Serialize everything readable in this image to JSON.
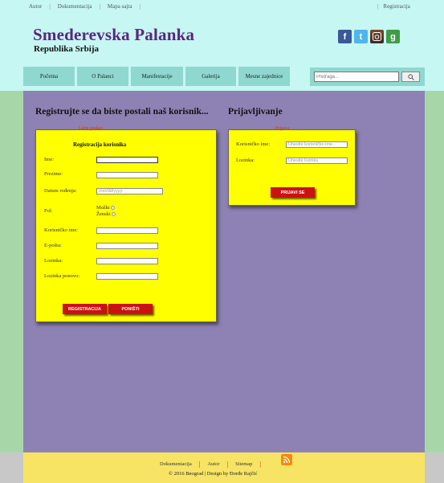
{
  "header": {
    "top_links": [
      "Autor",
      "Dokumentacija",
      "Mapa sajta"
    ],
    "register_link": "Registracija",
    "site_title": "Smederevska Palanka",
    "site_subtitle": "Republika Srbija",
    "social_icons": [
      "facebook-icon",
      "twitter-icon",
      "instagram-icon",
      "google-plus-icon"
    ]
  },
  "nav": {
    "items": [
      "Početna",
      "O Palanci",
      "Manifestacije",
      "Galerija",
      "Mesne zajednice"
    ],
    "search_placeholder": "Pretraga..."
  },
  "registration": {
    "heading": "Registrujte se da biste postali naš korisnik...",
    "legend": "Lični podaci",
    "form_title": "Registracija korisnika",
    "fields": [
      {
        "label": "Ime:",
        "placeholder": ""
      },
      {
        "label": "Prezime:",
        "placeholder": ""
      },
      {
        "label": "Datum rođenja:",
        "placeholder": "mm/dd/yyyy"
      },
      {
        "label": "Pol:",
        "placeholder": ""
      },
      {
        "label": "Korisničko ime:",
        "placeholder": ""
      },
      {
        "label": "E-pošta:",
        "placeholder": ""
      },
      {
        "label": "Lozinka:",
        "placeholder": ""
      },
      {
        "label": "Lozinka ponovo:",
        "placeholder": ""
      }
    ],
    "gender_options": [
      "Muški",
      "Ženski"
    ],
    "register_button": "REGISTRACIJA",
    "reset_button": "PONIŠTI"
  },
  "login": {
    "heading": "Prijavljivanje",
    "legend": "Prijava",
    "fields": [
      {
        "label": "Korisničko ime:",
        "placeholder": "Unesite korisničko ime..."
      },
      {
        "label": "Lozinka:",
        "placeholder": "Unesite lozinku"
      }
    ],
    "submit_button": "PRIJAVI SE"
  },
  "footer": {
    "links": [
      "Dokumentacija",
      "Autor",
      "Sitemap"
    ],
    "copyright": "© 2016 Beograd | Design by Đorđe Rajčić"
  },
  "colors": {
    "header_bg": "#c6f7f3",
    "nav_bg": "#8fd8cf",
    "main_bg": "#8e82b4",
    "panel_bg": "#ffff00",
    "title_color": "#5b2580",
    "button_red": "#cc1111",
    "footer_bg": "#f7e465"
  }
}
